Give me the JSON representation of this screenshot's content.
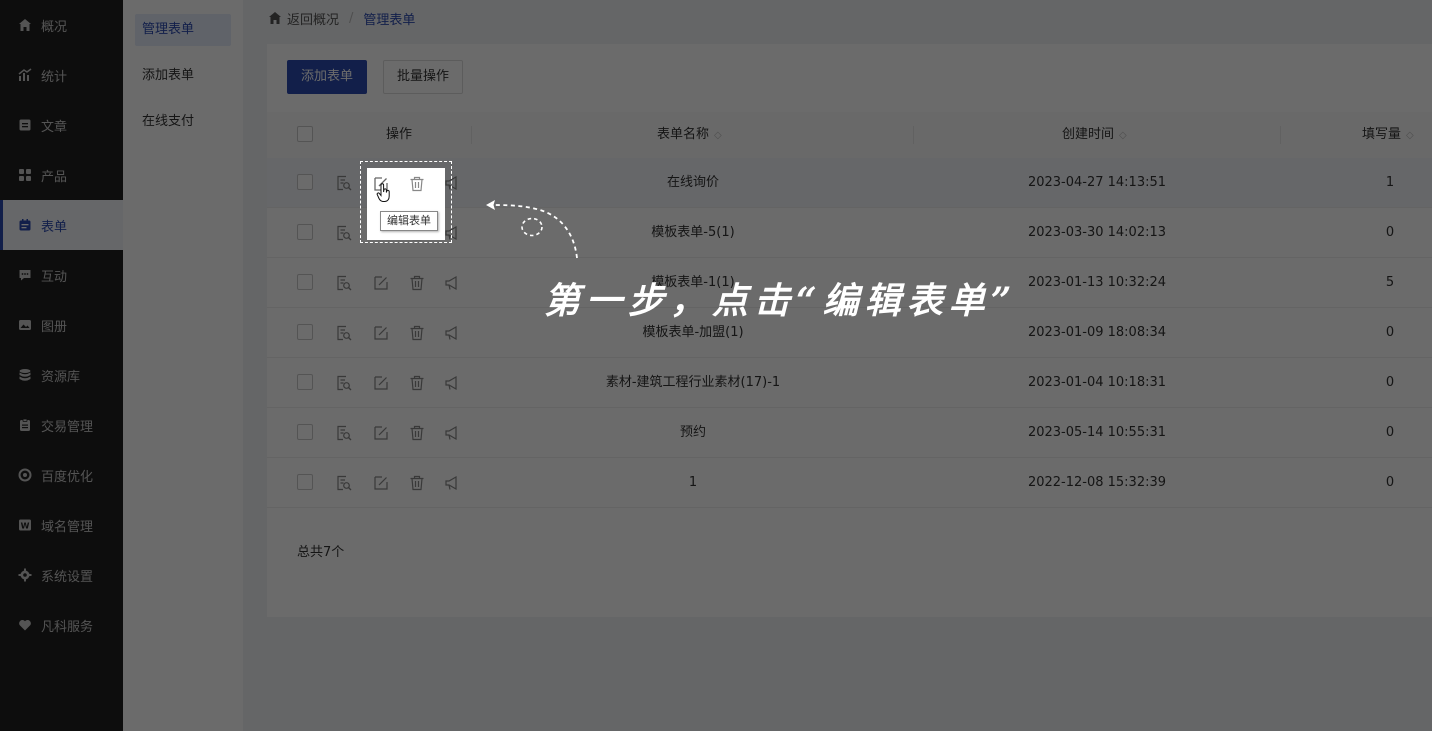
{
  "sidebar": {
    "items": [
      {
        "label": "概况",
        "icon": "home-icon"
      },
      {
        "label": "统计",
        "icon": "chart-icon"
      },
      {
        "label": "文章",
        "icon": "article-icon"
      },
      {
        "label": "产品",
        "icon": "grid-icon"
      },
      {
        "label": "表单",
        "icon": "calendar-icon"
      },
      {
        "label": "互动",
        "icon": "chat-icon"
      },
      {
        "label": "图册",
        "icon": "album-icon"
      },
      {
        "label": "资源库",
        "icon": "database-icon"
      },
      {
        "label": "交易管理",
        "icon": "clipboard-icon"
      },
      {
        "label": "百度优化",
        "icon": "refresh-icon"
      },
      {
        "label": "域名管理",
        "icon": "domain-icon"
      },
      {
        "label": "系统设置",
        "icon": "gear-icon"
      },
      {
        "label": "凡科服务",
        "icon": "heart-icon"
      }
    ],
    "active": "表单"
  },
  "subnav": {
    "items": [
      {
        "label": "管理表单"
      },
      {
        "label": "添加表单"
      },
      {
        "label": "在线支付"
      }
    ],
    "active": "管理表单"
  },
  "breadcrumb": {
    "back": "返回概况",
    "current": "管理表单"
  },
  "toolbar": {
    "add": "添加表单",
    "batch": "批量操作"
  },
  "table": {
    "headers": {
      "ops": "操作",
      "name": "表单名称",
      "created": "创建时间",
      "count": "填写量"
    },
    "rows": [
      {
        "name": "在线询价",
        "created": "2023-04-27 14:13:51",
        "count": "1"
      },
      {
        "name": "模板表单-5(1)",
        "created": "2023-03-30 14:02:13",
        "count": "0"
      },
      {
        "name": "模板表单-1(1)",
        "created": "2023-01-13 10:32:24",
        "count": "5"
      },
      {
        "name": "模板表单-加盟(1)",
        "created": "2023-01-09 18:08:34",
        "count": "0"
      },
      {
        "name": "素材-建筑工程行业素材(17)-1",
        "created": "2023-01-04 10:18:31",
        "count": "0"
      },
      {
        "name": "预约",
        "created": "2023-05-14 10:55:31",
        "count": "0"
      },
      {
        "name": "1",
        "created": "2022-12-08 15:32:39",
        "count": "0"
      }
    ],
    "total": "总共7个"
  },
  "tooltip": "编辑表单",
  "guide": "第一步，点击“编辑表单”",
  "colors": {
    "accent": "#2d4bb0",
    "sidebar_bg": "#1f1f1f",
    "overlay": "rgba(0,0,0,0.58)"
  }
}
